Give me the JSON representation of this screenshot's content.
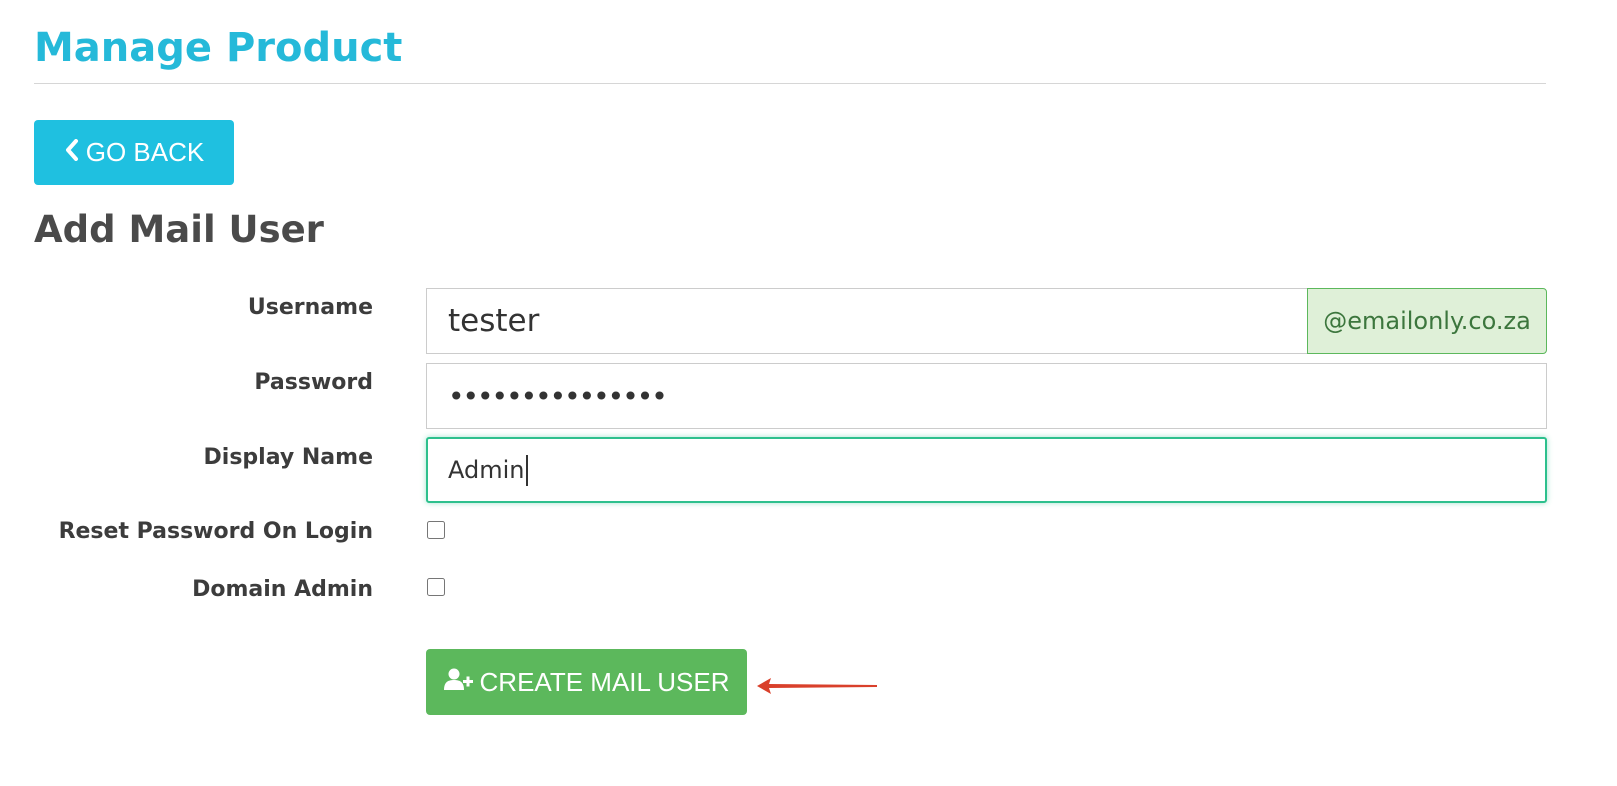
{
  "page": {
    "title": "Manage Product"
  },
  "toolbar": {
    "go_back_label": "GO BACK"
  },
  "form": {
    "heading": "Add Mail User",
    "username": {
      "label": "Username",
      "value": "tester",
      "domain_suffix": "@emailonly.co.za"
    },
    "password": {
      "label": "Password",
      "masked_value": "•••••••••••••••"
    },
    "display_name": {
      "label": "Display Name",
      "value": "Admin"
    },
    "reset_password": {
      "label": "Reset Password On Login",
      "checked": false
    },
    "domain_admin": {
      "label": "Domain Admin",
      "checked": false
    },
    "submit_label": "CREATE MAIL USER"
  },
  "icons": {
    "go_back": "chevron-left-icon",
    "create": "user-plus-icon",
    "annotation": "red-arrow-icon"
  },
  "colors": {
    "title": "#25b9d9",
    "go_back_bg": "#1fc0e0",
    "create_bg": "#5cb85c",
    "domain_addon_bg": "#dff0d8",
    "focus_border": "#2dc08d",
    "annotation_arrow": "#d9402b"
  }
}
